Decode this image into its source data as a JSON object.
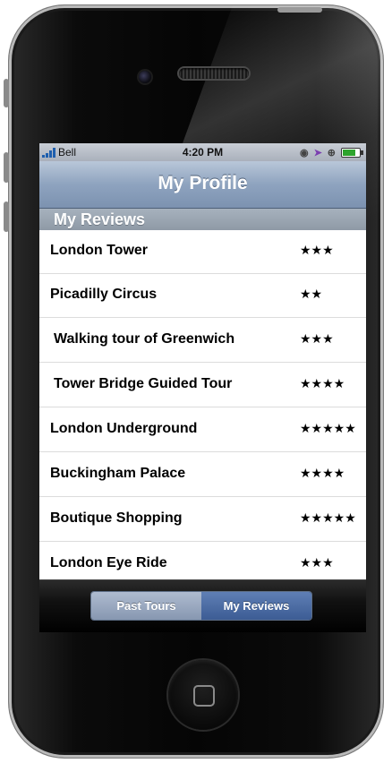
{
  "status_bar": {
    "carrier": "Bell",
    "time": "4:20 PM"
  },
  "nav": {
    "title": "My Profile"
  },
  "section": {
    "header": "My Reviews"
  },
  "reviews": [
    {
      "title": "London Tower",
      "stars": "★★★",
      "rating": 3
    },
    {
      "title": "Picadilly Circus",
      "stars": "★★",
      "rating": 2
    },
    {
      "title": "Walking tour of Greenwich",
      "stars": "★★★",
      "rating": 3
    },
    {
      "title": "Tower Bridge Guided Tour",
      "stars": "★★★★",
      "rating": 4
    },
    {
      "title": "London Underground",
      "stars": "★★★★★",
      "rating": 5
    },
    {
      "title": "Buckingham Palace",
      "stars": "★★★★",
      "rating": 4
    },
    {
      "title": "Boutique Shopping",
      "stars": "★★★★★",
      "rating": 5
    },
    {
      "title": "London Eye Ride",
      "stars": "★★★",
      "rating": 3
    }
  ],
  "tabs": {
    "past_tours": "Past Tours",
    "my_reviews": "My Reviews",
    "selected": "My Reviews"
  },
  "colors": {
    "nav_bar": "#8ea3bf",
    "section_header": "#98a3af",
    "segment_selected": "#4a6aa3",
    "segment_unselected": "#9aa8c0"
  }
}
